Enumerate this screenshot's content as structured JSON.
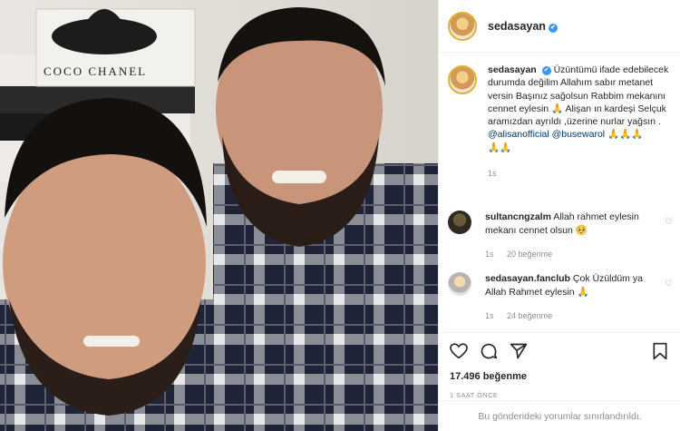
{
  "post": {
    "username": "sedasayan",
    "verified_mark": "✔",
    "photo_text": "COCO CHANEL"
  },
  "caption": {
    "username": "sedasayan",
    "text": "Üzüntümü ifade edebilecek durumda değilim Allahım sabır metanet versin Başınız sağolsun Rabbim mekanını cennet eylesin 🙏 Alişan ın kardeşi Selçuk aramızdan ayrıldı ,üzerine nurlar yağsın .",
    "mention1": "@alisanofficial",
    "mention2": "@busewarol",
    "emoji_tail1": " 🙏🙏🙏",
    "emoji_tail2": "🙏🙏",
    "time": "1s"
  },
  "comments": [
    {
      "username": "sultancngzalm",
      "text": "Allah rahmet eylesin mekanı cennet olsun 🥺",
      "time": "1s",
      "likes": "20 beğenme"
    },
    {
      "username": "sedasayan.fanclub",
      "text": "Çok Üzüldüm ya Allah Rahmet eylesin 🙏",
      "time": "1s",
      "likes": "24 beğenme"
    }
  ],
  "actions": {
    "likes": "17.496 beğenme",
    "posted": "1 SAAT ÖNCE"
  },
  "footer": {
    "text": "Bu gönderideki yorumlar sınırlandırıldı."
  },
  "colors": {
    "verified": "#3897f0",
    "mention": "#00376b",
    "muted": "#8e8e8e"
  }
}
